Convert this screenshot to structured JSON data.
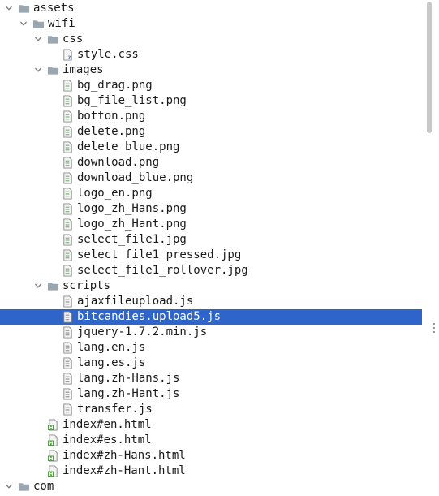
{
  "tree": {
    "rows": [
      {
        "label": "assets",
        "depth": 0,
        "kind": "folder",
        "expanded": true,
        "selected": false
      },
      {
        "label": "wifi",
        "depth": 1,
        "kind": "folder",
        "expanded": true,
        "selected": false
      },
      {
        "label": "css",
        "depth": 2,
        "kind": "folder",
        "expanded": true,
        "selected": false
      },
      {
        "label": "style.css",
        "depth": 3,
        "kind": "css-file",
        "selected": false
      },
      {
        "label": "images",
        "depth": 2,
        "kind": "folder",
        "expanded": true,
        "selected": false
      },
      {
        "label": "bg_drag.png",
        "depth": 3,
        "kind": "image-file",
        "selected": false
      },
      {
        "label": "bg_file_list.png",
        "depth": 3,
        "kind": "image-file",
        "selected": false
      },
      {
        "label": "botton.png",
        "depth": 3,
        "kind": "image-file",
        "selected": false
      },
      {
        "label": "delete.png",
        "depth": 3,
        "kind": "image-file",
        "selected": false
      },
      {
        "label": "delete_blue.png",
        "depth": 3,
        "kind": "image-file",
        "selected": false
      },
      {
        "label": "download.png",
        "depth": 3,
        "kind": "image-file",
        "selected": false
      },
      {
        "label": "download_blue.png",
        "depth": 3,
        "kind": "image-file",
        "selected": false
      },
      {
        "label": "logo_en.png",
        "depth": 3,
        "kind": "image-file",
        "selected": false
      },
      {
        "label": "logo_zh_Hans.png",
        "depth": 3,
        "kind": "image-file",
        "selected": false
      },
      {
        "label": "logo_zh_Hant.png",
        "depth": 3,
        "kind": "image-file",
        "selected": false
      },
      {
        "label": "select_file1.jpg",
        "depth": 3,
        "kind": "image-file",
        "selected": false
      },
      {
        "label": "select_file1_pressed.jpg",
        "depth": 3,
        "kind": "image-file",
        "selected": false
      },
      {
        "label": "select_file1_rollover.jpg",
        "depth": 3,
        "kind": "image-file",
        "selected": false
      },
      {
        "label": "scripts",
        "depth": 2,
        "kind": "folder",
        "expanded": true,
        "selected": false
      },
      {
        "label": "ajaxfileupload.js",
        "depth": 3,
        "kind": "js-file",
        "selected": false
      },
      {
        "label": "bitcandies.upload5.js",
        "depth": 3,
        "kind": "js-file",
        "selected": true
      },
      {
        "label": "jquery-1.7.2.min.js",
        "depth": 3,
        "kind": "js-file",
        "selected": false
      },
      {
        "label": "lang.en.js",
        "depth": 3,
        "kind": "js-file",
        "selected": false
      },
      {
        "label": "lang.es.js",
        "depth": 3,
        "kind": "js-file",
        "selected": false
      },
      {
        "label": "lang.zh-Hans.js",
        "depth": 3,
        "kind": "js-file",
        "selected": false
      },
      {
        "label": "lang.zh-Hant.js",
        "depth": 3,
        "kind": "js-file",
        "selected": false
      },
      {
        "label": "transfer.js",
        "depth": 3,
        "kind": "js-file",
        "selected": false
      },
      {
        "label": "index#en.html",
        "depth": 2,
        "kind": "html-file",
        "selected": false
      },
      {
        "label": "index#es.html",
        "depth": 2,
        "kind": "html-file",
        "selected": false
      },
      {
        "label": "index#zh-Hans.html",
        "depth": 2,
        "kind": "html-file",
        "selected": false
      },
      {
        "label": "index#zh-Hant.html",
        "depth": 2,
        "kind": "html-file",
        "selected": false
      },
      {
        "label": "com",
        "depth": 0,
        "kind": "folder",
        "expanded": true,
        "selected": false
      }
    ]
  },
  "colors": {
    "selection": "#2f65ca",
    "folder": "#9aa7b0",
    "html_badge": "#4fa33f"
  },
  "icons": {
    "folder": "folder-icon",
    "css-file": "css-file-icon",
    "image-file": "image-file-icon",
    "js-file": "js-file-icon",
    "html-file": "html-file-icon",
    "expanded": "chevron-down-icon"
  }
}
